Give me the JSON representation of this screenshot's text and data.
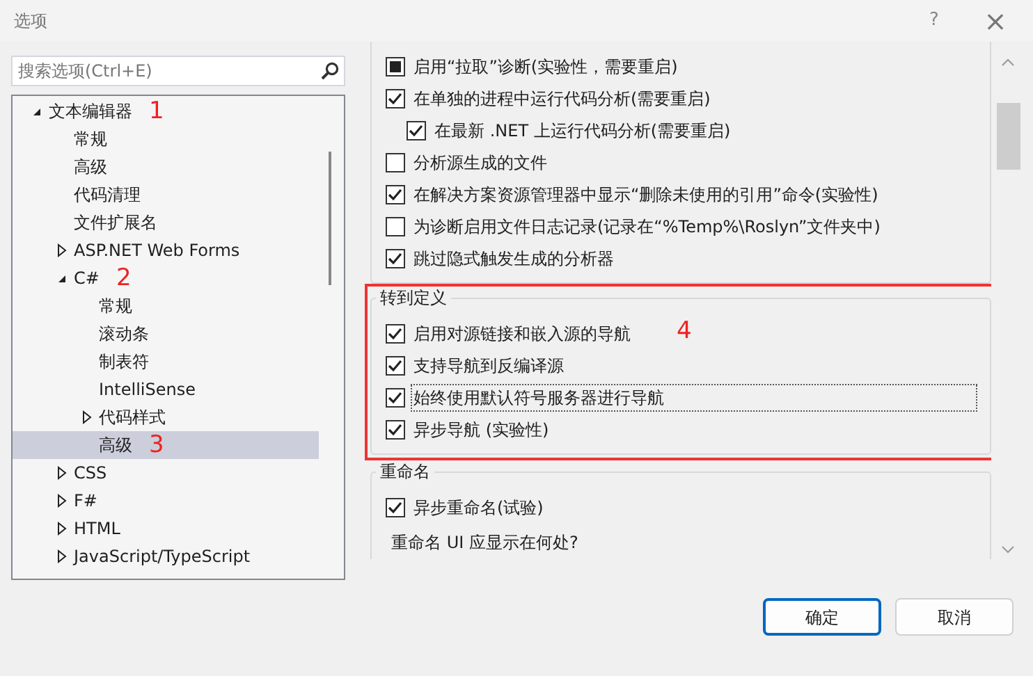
{
  "window": {
    "title": "选项",
    "help": "?",
    "close": "×"
  },
  "search": {
    "placeholder": "搜索选项(Ctrl+E)"
  },
  "tree": [
    {
      "label": "文本编辑器",
      "expanded": true,
      "selected": false,
      "annotation": "1",
      "children": [
        {
          "label": "常规",
          "selected": false
        },
        {
          "label": "高级",
          "selected": false
        },
        {
          "label": "代码清理",
          "selected": false
        },
        {
          "label": "文件扩展名",
          "selected": false
        },
        {
          "label": "ASP.NET Web Forms",
          "expanded": false,
          "selected": false
        },
        {
          "label": "C#",
          "expanded": true,
          "selected": false,
          "annotation": "2",
          "children": [
            {
              "label": "常规",
              "selected": false
            },
            {
              "label": "滚动条",
              "selected": false
            },
            {
              "label": "制表符",
              "selected": false
            },
            {
              "label": "IntelliSense",
              "selected": false
            },
            {
              "label": "代码样式",
              "expanded": false,
              "selected": false
            },
            {
              "label": "高级",
              "selected": true,
              "annotation": "3"
            }
          ]
        },
        {
          "label": "CSS",
          "expanded": false,
          "selected": false
        },
        {
          "label": "F#",
          "expanded": false,
          "selected": false
        },
        {
          "label": "HTML",
          "expanded": false,
          "selected": false
        },
        {
          "label": "JavaScript/TypeScript",
          "expanded": false,
          "selected": false
        }
      ]
    }
  ],
  "groups": [
    {
      "highlighted": false,
      "items": [
        {
          "kind": "checkbox",
          "label": "启用“拉取”诊断(实验性，需要重启)",
          "checked": false,
          "indeterminate": true,
          "focused": false
        },
        {
          "kind": "checkbox",
          "label": "在单独的进程中运行代码分析(需要重启)",
          "checked": true,
          "indeterminate": false,
          "focused": false
        },
        {
          "kind": "checkbox",
          "label": "在最新 .NET 上运行代码分析(需要重启)",
          "checked": true,
          "indeterminate": false,
          "focused": false,
          "sub": true
        },
        {
          "kind": "checkbox",
          "label": "分析源生成的文件",
          "checked": false,
          "indeterminate": false,
          "focused": false
        },
        {
          "kind": "checkbox",
          "label": "在解决方案资源管理器中显示“删除未使用的引用”命令(实验性)",
          "checked": true,
          "indeterminate": false,
          "focused": false
        },
        {
          "kind": "checkbox",
          "label": "为诊断启用文件日志记录(记录在“%Temp%\\Roslyn”文件夹中)",
          "checked": false,
          "indeterminate": false,
          "focused": false
        },
        {
          "kind": "checkbox",
          "label": "跳过隐式触发生成的分析器",
          "checked": true,
          "indeterminate": false,
          "focused": false
        }
      ]
    },
    {
      "title": "转到定义",
      "highlighted": true,
      "annotation": "4",
      "items": [
        {
          "kind": "checkbox",
          "label": "启用对源链接和嵌入源的导航",
          "checked": true,
          "indeterminate": false,
          "focused": false
        },
        {
          "kind": "checkbox",
          "label": "支持导航到反编译源",
          "checked": true,
          "indeterminate": false,
          "focused": false
        },
        {
          "kind": "checkbox",
          "label": "始终使用默认符号服务器进行导航",
          "checked": true,
          "indeterminate": false,
          "focused": true
        },
        {
          "kind": "checkbox",
          "label": "异步导航 (实验性)",
          "checked": true,
          "indeterminate": false,
          "focused": false
        }
      ]
    },
    {
      "title": "重命名",
      "highlighted": false,
      "items": [
        {
          "kind": "checkbox",
          "label": "异步重命名(试验)",
          "checked": true,
          "indeterminate": false,
          "focused": false
        },
        {
          "kind": "label",
          "label": "重命名 UI 应显示在何处?"
        }
      ]
    }
  ],
  "buttons": [
    {
      "label": "确定",
      "primary": true
    },
    {
      "label": "取消",
      "primary": false
    }
  ]
}
